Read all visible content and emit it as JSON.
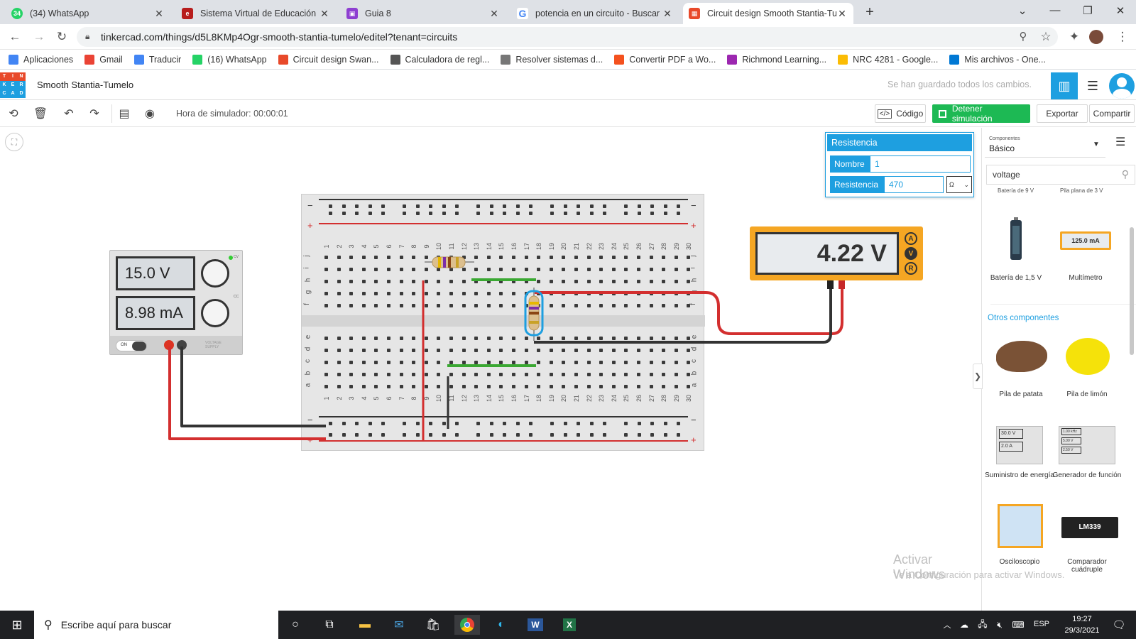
{
  "browser": {
    "tabs": [
      {
        "title": "(34) WhatsApp",
        "icon": "whatsapp-icon",
        "color": "#25d366"
      },
      {
        "title": "Sistema Virtual de Educación [Co",
        "icon": "edu-icon",
        "color": "#b71c1c"
      },
      {
        "title": "Guia 8",
        "icon": "classroom-icon",
        "color": "#8e3fd1"
      },
      {
        "title": "potencia en un circuito - Buscar c",
        "icon": "google-icon",
        "color": "#4285f4"
      },
      {
        "title": "Circuit design Smooth Stantia-Tu",
        "icon": "tinkercad-icon",
        "color": "#e8492a",
        "active": true
      }
    ],
    "url": "tinkercad.com/things/d5L8KMp4Ogr-smooth-stantia-tumelo/editel?tenant=circuits",
    "bookmarks": [
      {
        "label": "Aplicaciones",
        "icon": "apps-grid-icon",
        "color": "#4285f4"
      },
      {
        "label": "Gmail",
        "icon": "gmail-icon",
        "color": "#ea4335"
      },
      {
        "label": "Traducir",
        "icon": "translate-icon",
        "color": "#4285f4"
      },
      {
        "label": "(16) WhatsApp",
        "icon": "whatsapp-icon",
        "color": "#25d366"
      },
      {
        "label": "Circuit design Swan...",
        "icon": "tinkercad-icon",
        "color": "#e8492a"
      },
      {
        "label": "Calculadora de regl...",
        "icon": "calc-icon",
        "color": "#555555"
      },
      {
        "label": "Resolver sistemas d...",
        "icon": "math-icon",
        "color": "#777777"
      },
      {
        "label": "Convertir PDF a Wo...",
        "icon": "pdf-icon",
        "color": "#f4511e"
      },
      {
        "label": "Richmond Learning...",
        "icon": "richmond-icon",
        "color": "#9c27b0"
      },
      {
        "label": "NRC 4281 - Google...",
        "icon": "drive-icon",
        "color": "#fbbc04"
      },
      {
        "label": "Mis archivos - One...",
        "icon": "onedrive-icon",
        "color": "#0078d4"
      }
    ]
  },
  "app": {
    "project_name": "Smooth Stantia-Tumelo",
    "save_status": "Se han guardado todos los cambios.",
    "sim_time": "Hora de simulador: 00:00:01",
    "buttons": {
      "code": "Código",
      "stop": "Detener simulación",
      "export": "Exportar",
      "share": "Compartir"
    },
    "accent": "#1e9fe0",
    "stop_color": "#1db954"
  },
  "inspector": {
    "title": "Resistencia",
    "name_label": "Nombre",
    "name_value": "1",
    "res_label": "Resistencia",
    "res_value": "470",
    "unit": "Ω"
  },
  "power_supply": {
    "voltage": "15.0 V",
    "current": "8.98 mA",
    "on_label": "ON",
    "cv_label": "CV",
    "cc_label": "CC",
    "brand": "VOLTAGE SUPPLY"
  },
  "multimeter": {
    "reading": "4.22 V",
    "modes": [
      "A",
      "V",
      "R"
    ]
  },
  "breadboard": {
    "rows_top": [
      "j",
      "i",
      "h",
      "g",
      "f"
    ],
    "rows_bottom": [
      "e",
      "d",
      "c",
      "b",
      "a"
    ],
    "columns": 30
  },
  "panel": {
    "components_label": "Componentes",
    "category": "Básico",
    "search_value": "voltage",
    "cut_labels": [
      "Batería de 9 V",
      "Pila plana de 3 V"
    ],
    "section_other": "Otros componentes",
    "items": [
      {
        "label": "Batería de 1,5 V",
        "icon": "battery-icon"
      },
      {
        "label": "Multímetro",
        "icon": "multimeter-icon",
        "display": "125.0 mA"
      },
      {
        "label": "Pila de patata",
        "icon": "potato-battery-icon"
      },
      {
        "label": "Pila de limón",
        "icon": "lemon-battery-icon"
      },
      {
        "label": "Suministro de energía",
        "icon": "power-supply-icon",
        "display1": "30.0 V",
        "display2": "2.0 A"
      },
      {
        "label": "Generador de función",
        "icon": "function-generator-icon",
        "display1": "1.00 kHz",
        "display2": "5.00 V",
        "display3": "2.50 V"
      },
      {
        "label": "Osciloscopio",
        "icon": "oscilloscope-icon"
      },
      {
        "label": "Comparador cuádruple",
        "icon": "comparator-icon",
        "chip": "LM339"
      }
    ]
  },
  "watermark": {
    "line1": "Activar Windows",
    "line2": "Ve a Configuración para activar Windows."
  },
  "taskbar": {
    "search_placeholder": "Escribe aquí para buscar",
    "lang": "ESP",
    "time": "19:27",
    "date": "29/3/2021"
  }
}
